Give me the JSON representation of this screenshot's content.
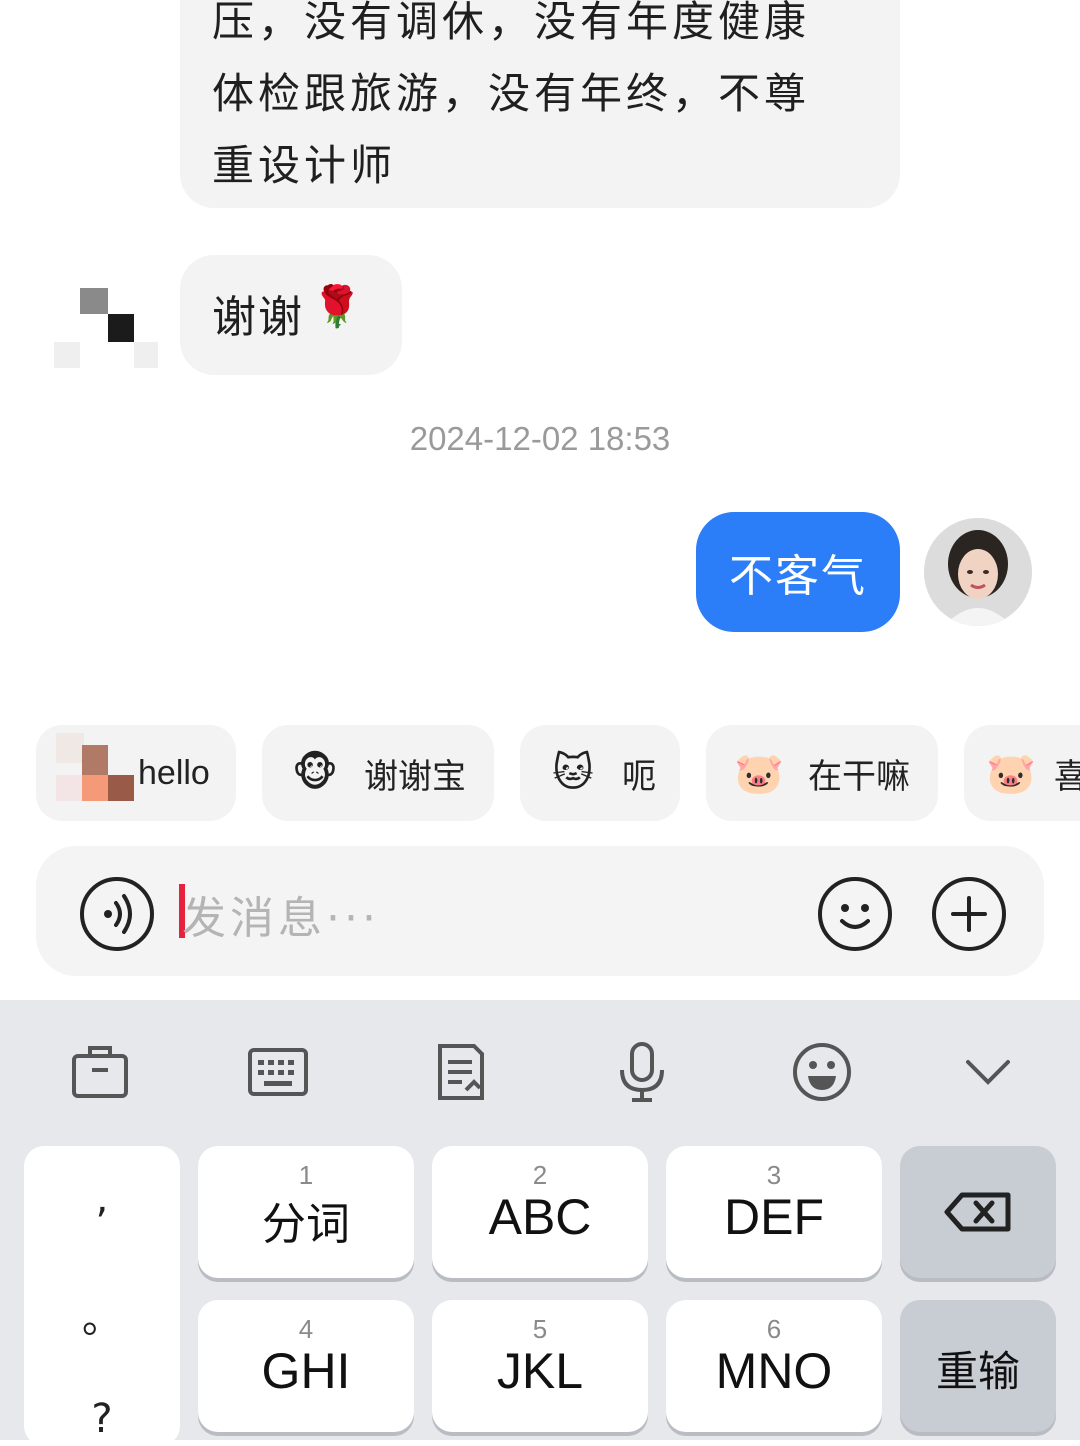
{
  "chat": {
    "incoming_long": {
      "line1": "压，没有调休，没有年度健康",
      "line2": "体检跟旅游，没有年终，不尊",
      "line3": "重设计师"
    },
    "incoming_thanks": {
      "text": "谢谢",
      "emoji": "🌹"
    },
    "timestamp": "2024-12-02 18:53",
    "outgoing": {
      "text": "不客气"
    }
  },
  "quick_replies": [
    {
      "label": "hello"
    },
    {
      "label": "谢谢宝",
      "emoji": "🐵"
    },
    {
      "label": "呃",
      "emoji": "🐱"
    },
    {
      "label": "在干嘛",
      "emoji": "🐷"
    },
    {
      "label": "喜",
      "emoji": "🐷"
    }
  ],
  "input": {
    "placeholder": "发消息···"
  },
  "keyboard": {
    "punct": [
      ",",
      "。",
      "?"
    ],
    "keys": [
      {
        "num": "1",
        "label": "分词"
      },
      {
        "num": "2",
        "label": "ABC"
      },
      {
        "num": "3",
        "label": "DEF"
      },
      {
        "num": "4",
        "label": "GHI"
      },
      {
        "num": "5",
        "label": "JKL"
      },
      {
        "num": "6",
        "label": "MNO"
      }
    ],
    "reenter_label": "重输"
  },
  "colors": {
    "accent_blue": "#2b7ef8",
    "cursor_red": "#e6233f",
    "bubble_gray": "#f3f3f3",
    "keyboard_bg": "#e6e8ec"
  }
}
